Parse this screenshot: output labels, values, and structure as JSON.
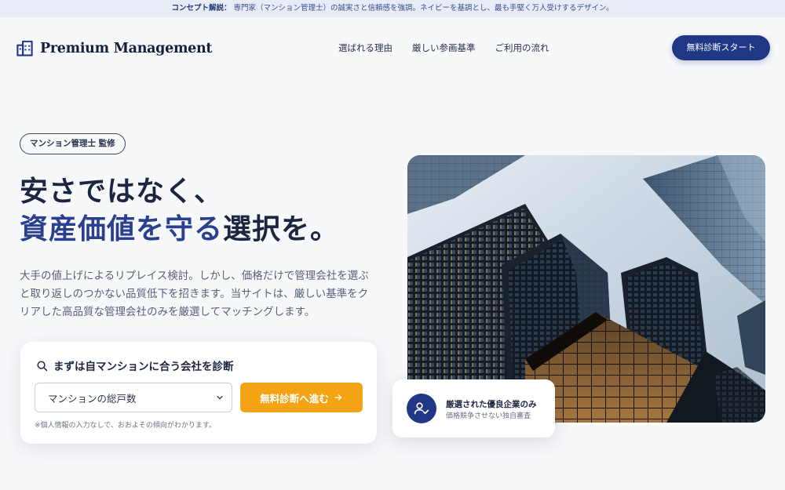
{
  "concept": {
    "label": "コンセプト解説：",
    "text": "専門家（マンション管理士）の誠実さと信頼感を強調。ネイビーを基調とし、最も手堅く万人受けするデザイン。"
  },
  "header": {
    "brand": "Premium Management",
    "logo_icon": "building-icon",
    "nav": [
      "選ばれる理由",
      "厳しい参画基準",
      "ご利用の流れ"
    ],
    "cta_label": "無料診断スタート"
  },
  "hero": {
    "badge": "マンション管理士 監修",
    "headline_line1": "安さではなく、",
    "headline_line2_accent": "資産価値を守る",
    "headline_line2_rest": "選択を。",
    "lead": "大手の値上げによるリプレイス検討。しかし、価格だけで管理会社を選ぶと取り返しのつかない品質低下を招きます。当サイトは、厳しい基準をクリアした高品質な管理会社のみを厳選してマッチングします。"
  },
  "diagnosis": {
    "title": "まずは自マンションに合う会社を診断",
    "title_icon": "search-icon",
    "select_value": "マンションの総戸数",
    "button_label": "無料診断へ進む",
    "button_icon": "arrow-right-icon",
    "note": "※個人情報の入力なしで、おおよその傾向がわかります。"
  },
  "feature": {
    "icon": "user-check-icon",
    "title": "厳選された優良企業のみ",
    "subtitle": "価格競争させない独自審査"
  },
  "colors": {
    "navy": "#203785",
    "accent_text": "#2b3f8f",
    "orange": "#f4a315",
    "background": "#f7f8fa"
  }
}
